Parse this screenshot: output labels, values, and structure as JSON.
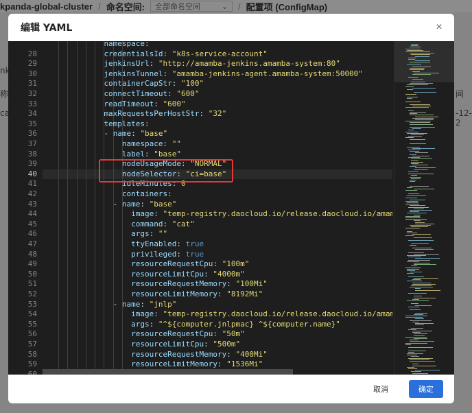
{
  "background": {
    "cluster": "kpanda-global-cluster",
    "namespace_label": "命名空间:",
    "namespace_value": "全部命名空间",
    "separator": "/",
    "page_title": "配置项 (ConfigMap)",
    "frag_left_1": "nki",
    "frag_left_2": "称",
    "frag_left_3": "cas",
    "frag_right_1": "间",
    "frag_right_2": "-12-2"
  },
  "modal": {
    "title": "编辑 YAML",
    "close_glyph": "×",
    "cancel_label": "取消",
    "confirm_label": "确定"
  },
  "editor": {
    "active_line": 40,
    "lines": [
      {
        "no": "28",
        "indent": 6,
        "key": "credentialsId",
        "val": "\"k8s-service-account\""
      },
      {
        "no": "29",
        "indent": 6,
        "key": "jenkinsUrl",
        "val": "\"http://amamba-jenkins.amamba-system:80\""
      },
      {
        "no": "30",
        "indent": 6,
        "key": "jenkinsTunnel",
        "val": "\"amamba-jenkins-agent.amamba-system:50000\""
      },
      {
        "no": "31",
        "indent": 6,
        "key": "containerCapStr",
        "val": "\"100\""
      },
      {
        "no": "32",
        "indent": 6,
        "key": "connectTimeout",
        "val": "\"600\""
      },
      {
        "no": "33",
        "indent": 6,
        "key": "readTimeout",
        "val": "\"600\""
      },
      {
        "no": "34",
        "indent": 6,
        "key": "maxRequestsPerHostStr",
        "val": "\"32\""
      },
      {
        "no": "35",
        "indent": 6,
        "key": "templates",
        "val": ""
      },
      {
        "no": "36",
        "indent": 7,
        "dash": true,
        "key": "name",
        "val": "\"base\""
      },
      {
        "no": "37",
        "indent": 8,
        "key": "namespace",
        "val": "\"\""
      },
      {
        "no": "38",
        "indent": 8,
        "key": "label",
        "val": "\"base\""
      },
      {
        "no": "39",
        "indent": 8,
        "key": "nodeUsageMode",
        "val": "\"NORMAL\""
      },
      {
        "no": "40",
        "indent": 8,
        "key": "nodeSelector",
        "val": "\"ci=base\""
      },
      {
        "no": "41",
        "indent": 8,
        "key": "idleMinutes",
        "val": "0"
      },
      {
        "no": "42",
        "indent": 8,
        "key": "containers",
        "val": ""
      },
      {
        "no": "43",
        "indent": 8,
        "dash": true,
        "key": "name",
        "val": "\"base\""
      },
      {
        "no": "44",
        "indent": 9,
        "key": "image",
        "val": "\"temp-registry.daocloud.io/release.daocloud.io/amamba/jenkins-"
      },
      {
        "no": "45",
        "indent": 9,
        "key": "command",
        "val": "\"cat\""
      },
      {
        "no": "46",
        "indent": 9,
        "key": "args",
        "val": "\"\""
      },
      {
        "no": "47",
        "indent": 9,
        "key": "ttyEnabled",
        "val": "true",
        "bool": true
      },
      {
        "no": "48",
        "indent": 9,
        "key": "privileged",
        "val": "true",
        "bool": true
      },
      {
        "no": "49",
        "indent": 9,
        "key": "resourceRequestCpu",
        "val": "\"100m\""
      },
      {
        "no": "50",
        "indent": 9,
        "key": "resourceLimitCpu",
        "val": "\"4000m\""
      },
      {
        "no": "51",
        "indent": 9,
        "key": "resourceRequestMemory",
        "val": "\"100Mi\""
      },
      {
        "no": "52",
        "indent": 9,
        "key": "resourceLimitMemory",
        "val": "\"8192Mi\""
      },
      {
        "no": "53",
        "indent": 8,
        "dash": true,
        "key": "name",
        "val": "\"jnlp\""
      },
      {
        "no": "54",
        "indent": 9,
        "key": "image",
        "val": "\"temp-registry.daocloud.io/release.daocloud.io/amamba/jenkins-"
      },
      {
        "no": "55",
        "indent": 9,
        "key": "args",
        "val": "\"^${computer.jnlpmac} ^${computer.name}\""
      },
      {
        "no": "56",
        "indent": 9,
        "key": "resourceRequestCpu",
        "val": "\"50m\""
      },
      {
        "no": "57",
        "indent": 9,
        "key": "resourceLimitCpu",
        "val": "\"500m\""
      },
      {
        "no": "58",
        "indent": 9,
        "key": "resourceRequestMemory",
        "val": "\"400Mi\""
      },
      {
        "no": "59",
        "indent": 9,
        "key": "resourceLimitMemory",
        "val": "\"1536Mi\""
      },
      {
        "no": "60",
        "indent": 8,
        "key": "workspaceVolume",
        "val": ""
      }
    ],
    "top_partial": {
      "no": "",
      "indent": 6,
      "key": "namespace",
      "val": ""
    }
  },
  "colors": {
    "editor_bg": "#1e1e1e",
    "key": "#9cdcfe",
    "string": "#e6db74",
    "bool": "#569cd6",
    "highlight_border": "#e53935",
    "primary_button": "#2a6fdb"
  }
}
